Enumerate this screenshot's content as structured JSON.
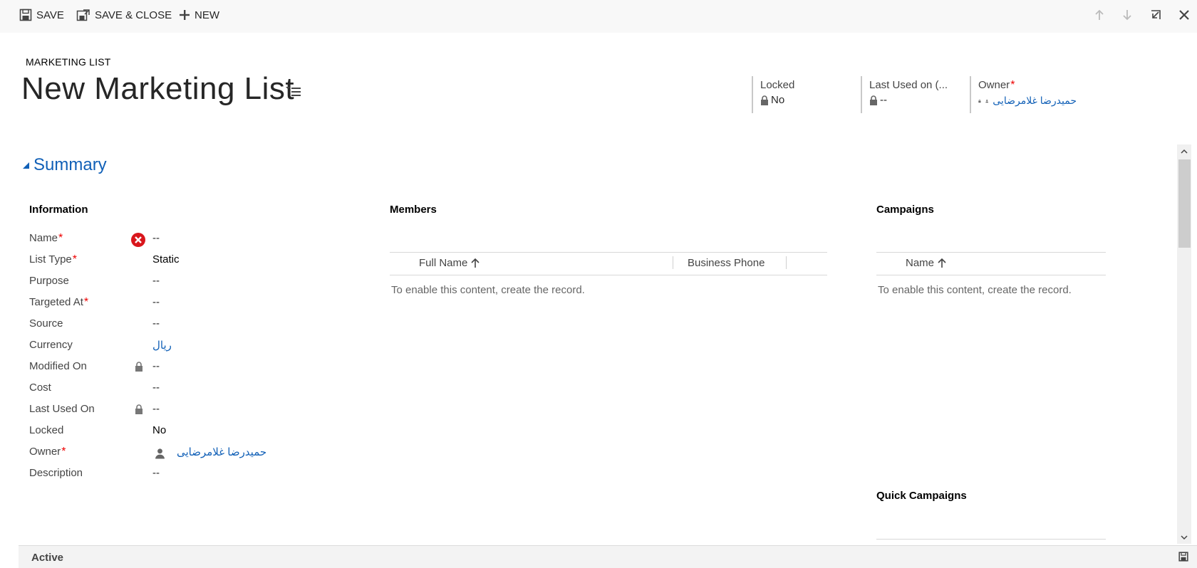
{
  "toolbar": {
    "save_label": "SAVE",
    "save_close_label": "SAVE & CLOSE",
    "new_label": "NEW"
  },
  "header": {
    "entity_label": "MARKETING LIST",
    "title": "New Marketing List",
    "fields": {
      "locked": {
        "label": "Locked",
        "value": "No"
      },
      "last_used": {
        "label": "Last Used on (...",
        "value": "--"
      },
      "owner": {
        "label": "Owner",
        "value": "حمیدرضا غلامرضایی"
      }
    }
  },
  "summary": {
    "section_title": "Summary",
    "information": {
      "title": "Information",
      "fields": [
        {
          "label": "Name",
          "required": true,
          "value": "--"
        },
        {
          "label": "List Type",
          "required": true,
          "value": "Static"
        },
        {
          "label": "Purpose",
          "required": false,
          "value": "--"
        },
        {
          "label": "Targeted At",
          "required": true,
          "value": "--"
        },
        {
          "label": "Source",
          "required": false,
          "value": "--"
        },
        {
          "label": "Currency",
          "required": false,
          "value": "ریال"
        },
        {
          "label": "Modified On",
          "required": false,
          "value": "--"
        },
        {
          "label": "Cost",
          "required": false,
          "value": "--"
        },
        {
          "label": "Last Used On",
          "required": false,
          "value": "--"
        },
        {
          "label": "Locked",
          "required": false,
          "value": "No"
        },
        {
          "label": "Owner",
          "required": true,
          "value": "حمیدرضا غلامرضایی"
        },
        {
          "label": "Description",
          "required": false,
          "value": "--"
        }
      ]
    },
    "members": {
      "title": "Members",
      "columns": [
        "Full Name",
        "Business Phone"
      ],
      "empty_message": "To enable this content, create the record."
    },
    "campaigns": {
      "title": "Campaigns",
      "columns": [
        "Name"
      ],
      "empty_message": "To enable this content, create the record."
    },
    "quick_campaigns": {
      "title": "Quick Campaigns"
    }
  },
  "footer": {
    "status": "Active"
  },
  "colors": {
    "accent": "#1160b7",
    "required": "#ee0000",
    "error": "#d9161c"
  }
}
